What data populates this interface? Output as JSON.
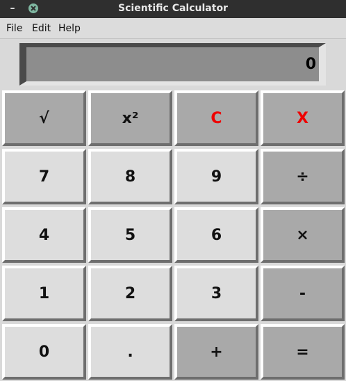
{
  "window": {
    "title": "Scientific Calculator"
  },
  "menu": {
    "items": [
      "File",
      "Edit",
      "Help"
    ]
  },
  "display": {
    "value": "0"
  },
  "buttons": {
    "sqrt": "√",
    "square": "x²",
    "clear": "C",
    "close": "X",
    "seven": "7",
    "eight": "8",
    "nine": "9",
    "divide": "÷",
    "four": "4",
    "five": "5",
    "six": "6",
    "multiply": "×",
    "one": "1",
    "two": "2",
    "three": "3",
    "minus": "-",
    "zero": "0",
    "dot": ".",
    "plus": "+",
    "equals": "="
  },
  "colors": {
    "accent_red": "#ee0000",
    "button_light": "#dddddd",
    "button_dark": "#a9a9a9"
  }
}
